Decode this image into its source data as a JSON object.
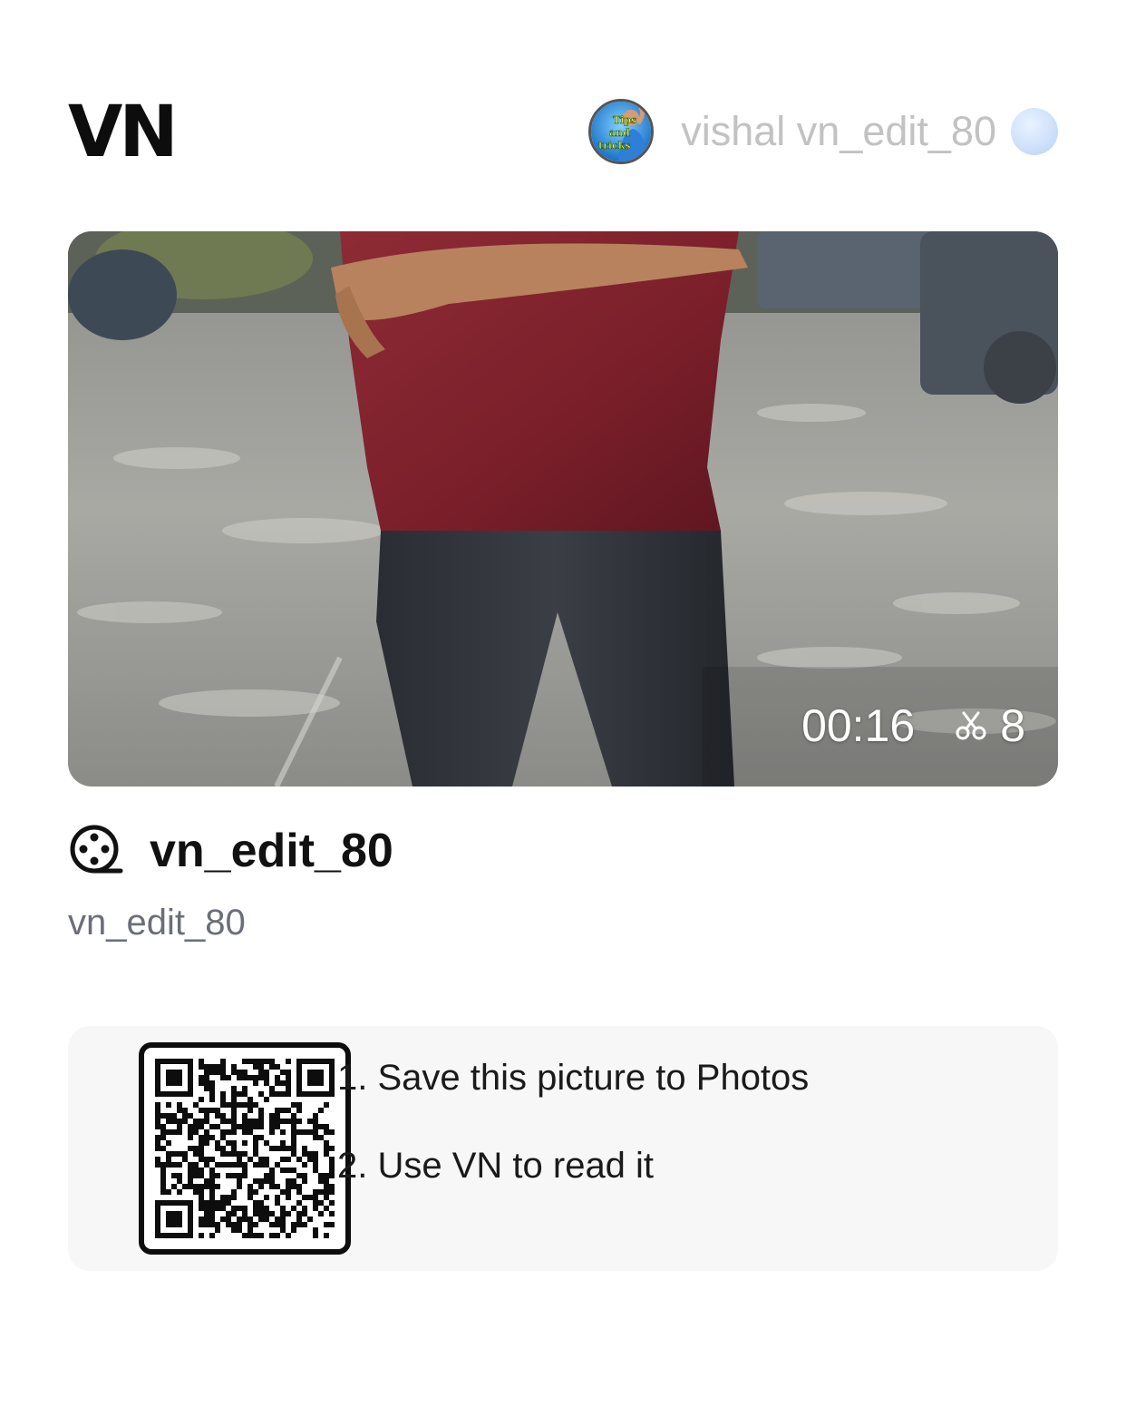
{
  "header": {
    "logo": "VN",
    "author_name": "vishal vn_edit_80",
    "avatar_text": [
      "Tips",
      "and",
      "tricks"
    ]
  },
  "video": {
    "duration": "00:16",
    "clip_count": "8"
  },
  "project": {
    "title": "vn_edit_80",
    "subtitle": "vn_edit_80"
  },
  "qr_card": {
    "step_1": "1. Save this picture to Photos",
    "step_2": "2. Use VN to read it"
  },
  "colors": {
    "author_text": "#c2c2c2",
    "subtitle_text": "#6b6e7a",
    "panel_bg": "#f7f7f7"
  }
}
